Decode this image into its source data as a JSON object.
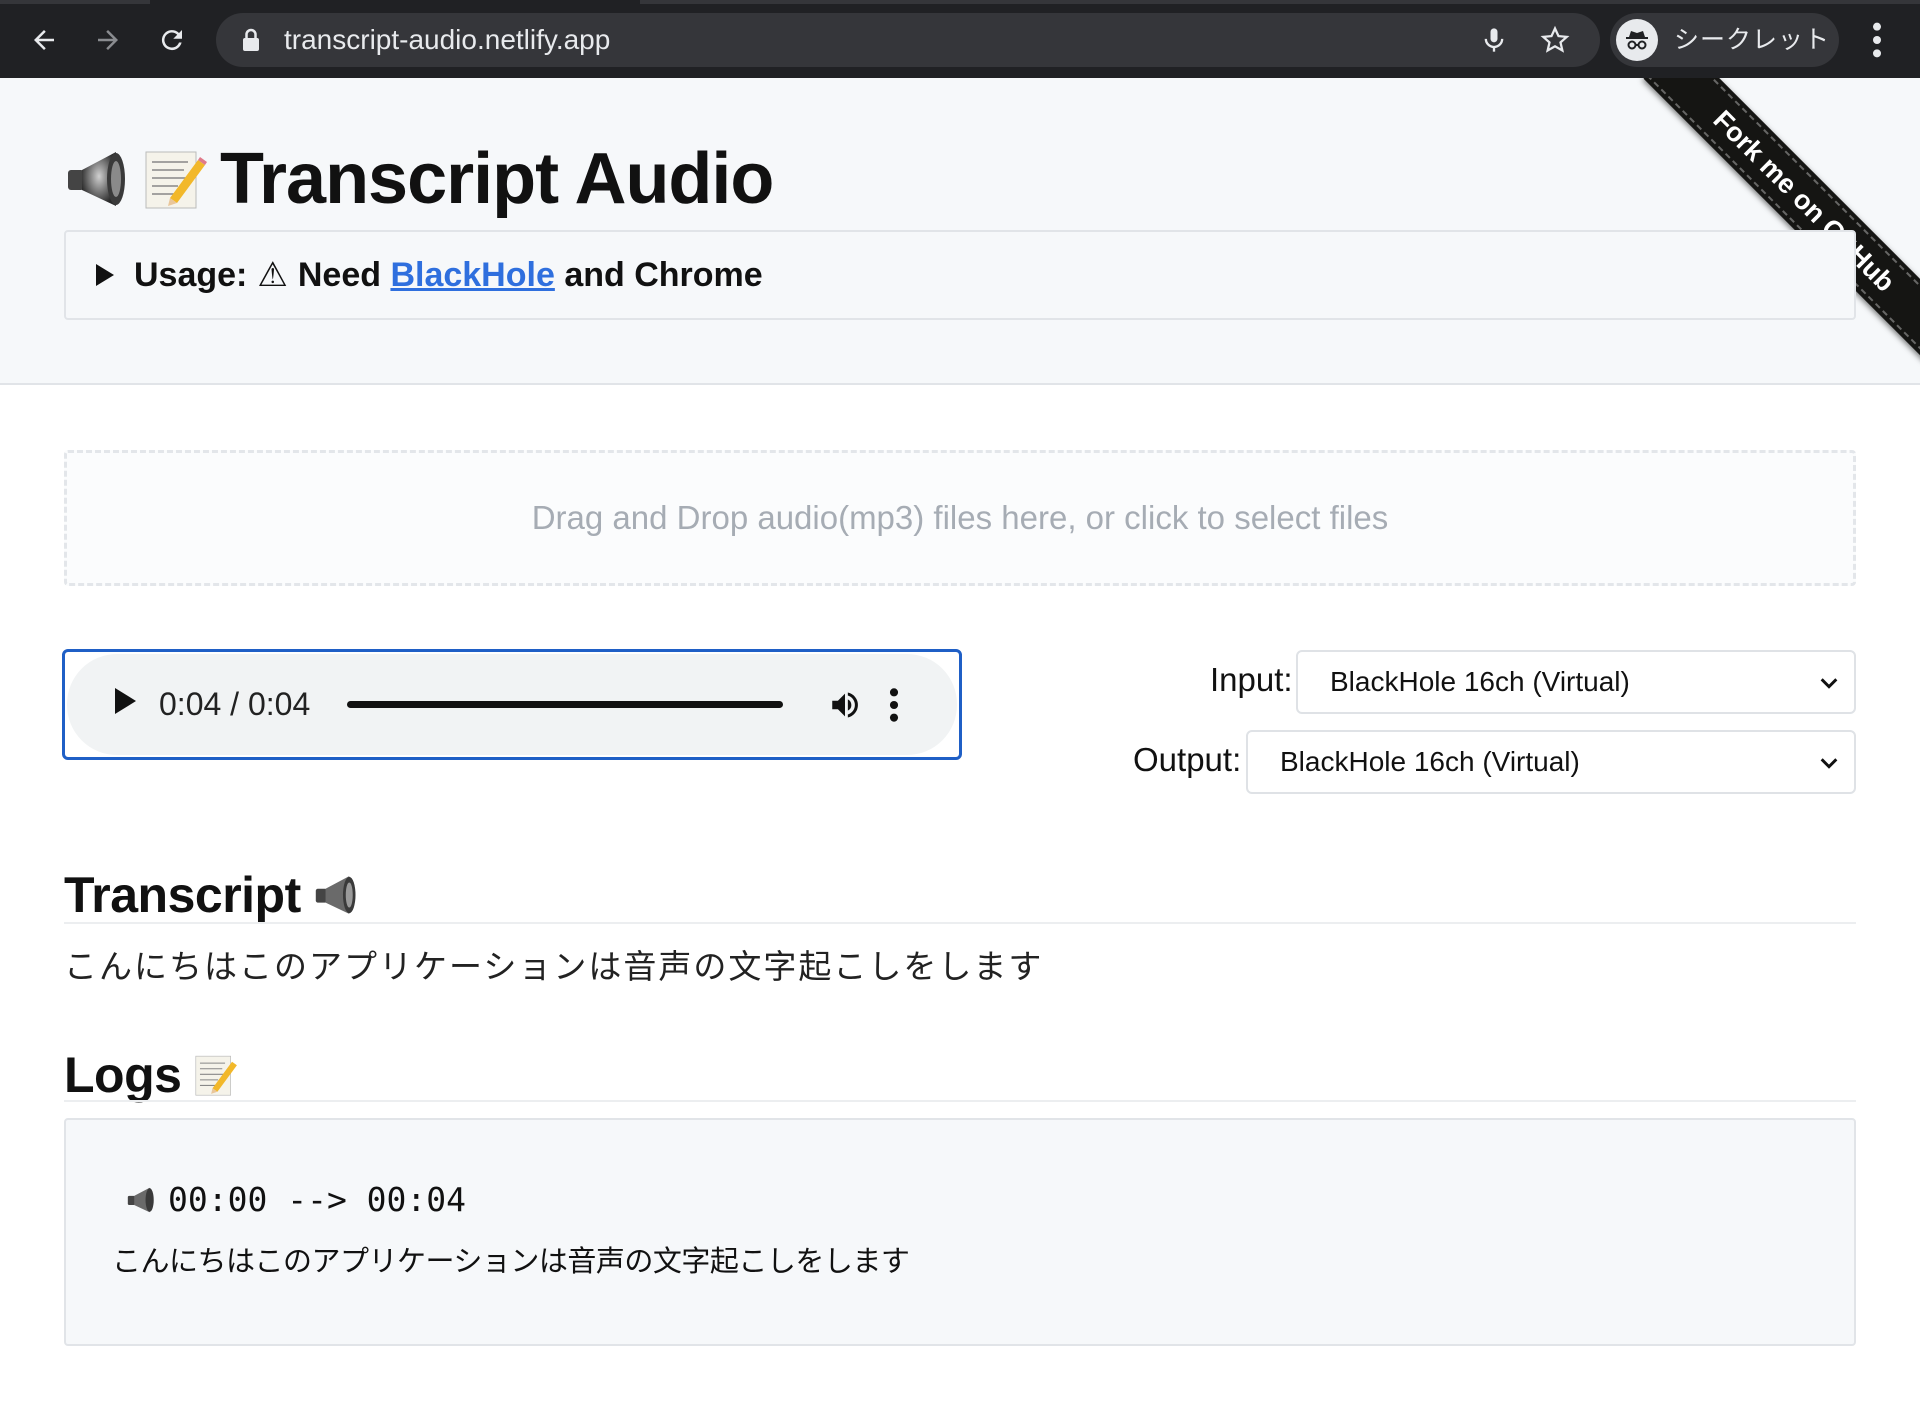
{
  "browser": {
    "url": "transcript-audio.netlify.app",
    "incognito_label": "シークレット",
    "icons": [
      "back-arrow-icon",
      "forward-arrow-icon",
      "reload-icon",
      "lock-icon",
      "mic-icon",
      "star-icon",
      "incognito-icon",
      "more-vert-icon"
    ]
  },
  "page": {
    "title": "Transcript Audio",
    "ribbon": "Fork me on GitHub",
    "usage": {
      "prefix": "Usage:",
      "warn_symbol": "⚠",
      "need": "Need",
      "link": "BlackHole",
      "suffix": "and Chrome"
    },
    "dropzone_text": "Drag and Drop audio(mp3) files here, or click to select files",
    "player": {
      "time": "0:04 / 0:04",
      "progress_fraction": 1.0
    },
    "devices": {
      "input_label": "Input:",
      "input_value": "BlackHole 16ch (Virtual)",
      "output_label": "Output:",
      "output_value": "BlackHole 16ch (Virtual)"
    },
    "transcript": {
      "heading": "Transcript",
      "text": "こんにちはこのアプリケーションは音声の文字起こしをします"
    },
    "logs": {
      "heading": "Logs",
      "entries": [
        {
          "time": "00:00 --> 00:04",
          "text": "こんにちはこのアプリケーションは音声の文字起こしをします"
        }
      ]
    }
  },
  "colors": {
    "chrome_bg": "#202124",
    "omnibox_bg": "#35363a",
    "link": "#2f6fde",
    "player_focus": "#1f5fc6",
    "header_bg": "#f6f8fa"
  }
}
